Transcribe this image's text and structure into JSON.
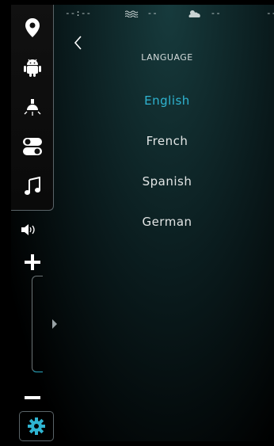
{
  "status_bar": {
    "time": "--:--",
    "sea": "--",
    "weather": "--",
    "extra": "--"
  },
  "rail": {
    "icons": [
      "location-pin-icon",
      "android-icon",
      "light-bulb-icon",
      "toggle-icon",
      "music-note-icon"
    ],
    "volume": {
      "plus_label": "+",
      "minus_label": "−"
    }
  },
  "main": {
    "title": "LANGUAGE",
    "languages": [
      {
        "label": "English",
        "selected": true
      },
      {
        "label": "French",
        "selected": false
      },
      {
        "label": "Spanish",
        "selected": false
      },
      {
        "label": "German",
        "selected": false
      }
    ]
  },
  "colors": {
    "accent": "#2fb4d1",
    "text": "#e3e6e6"
  }
}
